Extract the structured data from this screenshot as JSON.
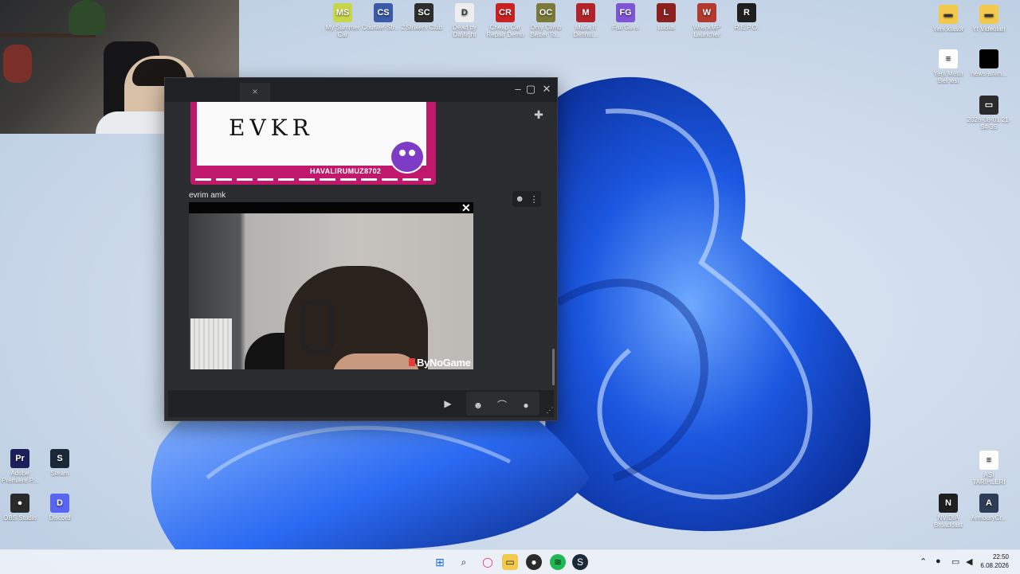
{
  "desktop_icons_top": [
    {
      "label": "My Summer Car",
      "color": "#c8d64a",
      "glyph": "MS"
    },
    {
      "label": "Counter-Str... 2",
      "color": "#3b5ba8",
      "glyph": "CS"
    },
    {
      "label": "Strikers Club",
      "color": "#2d2d2d",
      "glyph": "SC"
    },
    {
      "label": "Dead by Daylight",
      "color": "#eeeeee",
      "glyph": "D"
    },
    {
      "label": "Cheap Car Repair Demo",
      "color": "#c82222",
      "glyph": "CR"
    },
    {
      "label": "Only Climb Better To...",
      "color": "#7c7a3a",
      "glyph": "OC"
    },
    {
      "label": "Mafia II Definiti...",
      "color": "#b2242a",
      "glyph": "M"
    },
    {
      "label": "Fall Guys",
      "color": "#7f55d6",
      "glyph": "FG"
    },
    {
      "label": "Ludus",
      "color": "#8a2020",
      "glyph": "L"
    },
    {
      "label": "WreckMP Launcher",
      "color": "#b33a2c",
      "glyph": "W"
    },
    {
      "label": "R.E.P.O.",
      "color": "#1f1f1f",
      "glyph": "R"
    }
  ],
  "desktop_icons_right": [
    {
      "label": "Yeni klasör",
      "color": "#f2c94c",
      "glyph": "▬"
    },
    {
      "label": "Yt Videoları",
      "color": "#f2c94c",
      "glyph": "▬"
    },
    {
      "label": "Yeni Metin Belgesi",
      "color": "#ffffff",
      "glyph": "≡"
    },
    {
      "label": "news-anim...",
      "color": "#000000",
      "glyph": ""
    },
    {
      "label": "2026-08-01 21-54-35",
      "color": "#2b2b2b",
      "glyph": "▭"
    },
    {
      "label": "AŞI TARİHLERİ",
      "color": "#ffffff",
      "glyph": "≡"
    },
    {
      "label": "NVIDIA Broadcast",
      "color": "#1f1f1f",
      "glyph": "N"
    },
    {
      "label": "ArmouryCr...",
      "color": "#2c3d55",
      "glyph": "A"
    }
  ],
  "desktop_icons_left": [
    {
      "label": "Adobe Premiere P...",
      "color": "#1d1f5b",
      "glyph": "Pr"
    },
    {
      "label": "Steam",
      "color": "#1b2838",
      "glyph": "S"
    },
    {
      "label": "OBS Studio",
      "color": "#2a2a2a",
      "glyph": "●"
    },
    {
      "label": "Discord",
      "color": "#5865f2",
      "glyph": "D"
    }
  ],
  "chat": {
    "tab_label": "x",
    "tab_close": "×",
    "sticker_text": "EVKR",
    "sticker_handle": "HAVALIRUMUZ8702",
    "message_text": "evrim amk",
    "video_brand": "ByNoGame",
    "video_close": "✕"
  },
  "taskbar": {
    "time": "22:50",
    "date": "6.08.2026"
  },
  "colors": {
    "accent_blue": "#1d5bd8",
    "sticker_pink": "#c0186a"
  }
}
